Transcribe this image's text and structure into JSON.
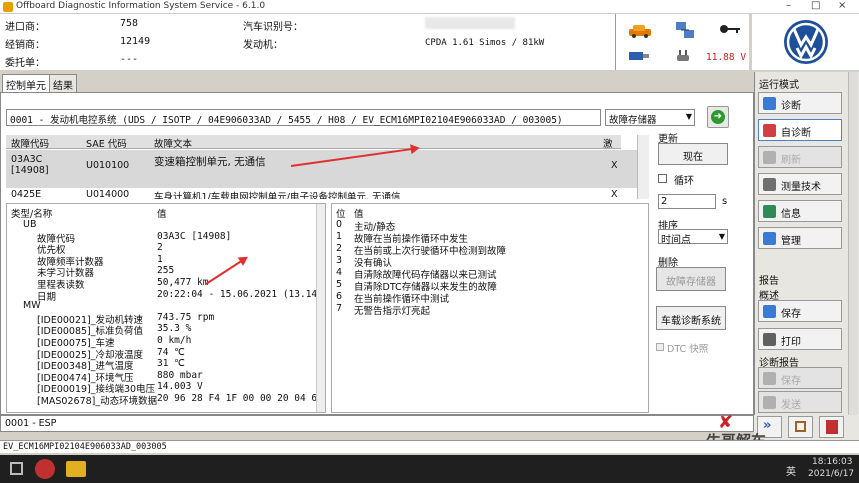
{
  "window": {
    "title": "Offboard Diagnostic Information System Service - 6.1.0",
    "controls": [
      "–",
      "□",
      "×"
    ]
  },
  "info": {
    "importer_label": "进口商：",
    "importer": "758",
    "dealer_label": "经销商：",
    "dealer": "12149",
    "client_label": "委托单：",
    "client": "---",
    "vin_label": "汽车识别号：",
    "engine_label": "发动机：",
    "engine": "CPDA 1.61 Simos / 81kW"
  },
  "status": {
    "voltage": "11.88 V"
  },
  "tabs": [
    "控制单元",
    "结果"
  ],
  "ecu": {
    "line": "0001 - 发动机电控系统  (UDS / ISOTP / 04E906033AD / 5455 / H08 / EV_ECM16MPI02104E906033AD / 003005)",
    "memory_select": "故障存储器"
  },
  "fault_table": {
    "headers": [
      "故障代码",
      "SAE 代码",
      "故障文本",
      "激活"
    ],
    "rows": [
      {
        "code": "03A3C",
        "code2": "[14908]",
        "sae": "U010100",
        "text": "变速箱控制单元, 无通信",
        "active": "X"
      },
      {
        "code": "0425E",
        "code2": "",
        "sae": "U014000",
        "text": "车身计算机1/车载电网控制单元/电子设备控制单元, 无通信",
        "active": "X"
      }
    ]
  },
  "right_panel": {
    "update_label": "更新",
    "now_button": "现在",
    "loop_label": "循环",
    "loop_value": "2",
    "unit_s": "s",
    "sort_label": "排序",
    "sort_value": "时间点",
    "delete_label": "删除",
    "delete_button": "故障存储器",
    "onboard_button": "车载诊断系统",
    "dtc_label": "DTC 快照"
  },
  "details": {
    "headers": [
      "类型/名称",
      "值"
    ],
    "rows": [
      {
        "name": "UB",
        "value": "",
        "indent": 1
      },
      {
        "name": "故障代码",
        "value": "03A3C [14908]",
        "indent": 2
      },
      {
        "name": "优先权",
        "value": "2",
        "indent": 2
      },
      {
        "name": "故障频率计数器",
        "value": "1",
        "indent": 2
      },
      {
        "name": "未学习计数器",
        "value": "255",
        "indent": 2
      },
      {
        "name": "里程表读数",
        "value": "50,477 km",
        "indent": 2
      },
      {
        "name": "日期",
        "value": "20:22:04 - 15.06.2021  (13.14.2",
        "indent": 2
      },
      {
        "name": "MW",
        "value": "",
        "indent": 1
      },
      {
        "name": "[IDE00021]_发动机转速",
        "value": "743.75 rpm",
        "indent": 2
      },
      {
        "name": "[IDE00085]_标准负荷值",
        "value": "35.3 %",
        "indent": 2
      },
      {
        "name": "[IDE00075]_车速",
        "value": "0 km/h",
        "indent": 2
      },
      {
        "name": "[IDE00025]_冷却液温度",
        "value": "74 ℃",
        "indent": 2
      },
      {
        "name": "[IDE00348]_进气温度",
        "value": "31 ℃",
        "indent": 2
      },
      {
        "name": "[IDE00474]_环境气压",
        "value": "880 mbar",
        "indent": 2
      },
      {
        "name": "[IDE00019]_接线端30电压",
        "value": "14.003 V",
        "indent": 2
      },
      {
        "name": "[MAS02678]_动态环境数据",
        "value": "20 96 28 F4 1F 00 00 20 04 6B 2E",
        "indent": 2
      }
    ]
  },
  "positions": {
    "headers": [
      "位",
      "值"
    ],
    "rows": [
      {
        "pos": "0",
        "value": "主动/静态"
      },
      {
        "pos": "1",
        "value": "故障在当前操作循环中发生"
      },
      {
        "pos": "2",
        "value": "在当前或上次行驶循环中检测到故障"
      },
      {
        "pos": "3",
        "value": "没有确认"
      },
      {
        "pos": "4",
        "value": "自清除故障代码存储器以来已测试"
      },
      {
        "pos": "5",
        "value": "自清除DTC存储器以来发生的故障"
      },
      {
        "pos": "6",
        "value": "在当前操作循环中测试"
      },
      {
        "pos": "7",
        "value": "无警告指示灯亮起"
      }
    ]
  },
  "esp": "0001 - ESP",
  "sidebar": {
    "mode_header": "运行模式",
    "mode_buttons": [
      {
        "label": "诊断",
        "state": "normal",
        "color": "#3a7bd5"
      },
      {
        "label": "自诊断",
        "state": "selected",
        "color": "#d04040"
      },
      {
        "label": "刷新",
        "state": "disabled",
        "color": "#b0b0b0"
      },
      {
        "label": "测量技术",
        "state": "normal",
        "color": "#707070"
      },
      {
        "label": "信息",
        "state": "normal",
        "color": "#2e8b57"
      },
      {
        "label": "管理",
        "state": "normal",
        "color": "#3a7bd5"
      }
    ],
    "report_header": "报告",
    "overview_label": "概述",
    "report_buttons": [
      {
        "label": "保存",
        "state": "normal",
        "color": "#3a7bd5"
      },
      {
        "label": "打印",
        "state": "normal",
        "color": "#606060"
      }
    ],
    "diag_report_label": "诊断报告",
    "diag_buttons": [
      {
        "label": "保存",
        "state": "disabled",
        "color": "#b0b0b0"
      },
      {
        "label": "发送",
        "state": "disabled",
        "color": "#b0b0b0"
      }
    ]
  },
  "path": "EV_ECM16MPI02104E906033AD_003005",
  "watermark": "牛哥解车",
  "taskbar": {
    "lang": "英",
    "time": "18:16:03",
    "date": "2021/6/17"
  }
}
